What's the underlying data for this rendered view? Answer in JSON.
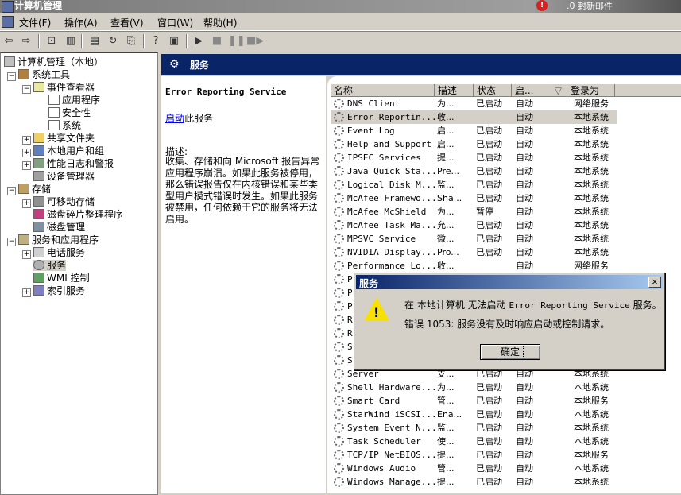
{
  "window": {
    "title": "计算机管理",
    "icon": "computer-management-icon"
  },
  "notification": {
    "text": ".0 封新邮件",
    "badge": "!"
  },
  "menu": [
    "文件(F)",
    "操作(A)",
    "查看(V)",
    "窗口(W)",
    "帮助(H)"
  ],
  "toolbar_icons": [
    "back-icon",
    "forward-icon",
    "up-icon",
    "show-tree-icon",
    "properties-icon",
    "refresh-icon",
    "export-icon",
    "help-icon",
    "console-icon",
    "play-icon",
    "stop-icon",
    "pause-icon",
    "restart-icon"
  ],
  "tree": {
    "root": "计算机管理（本地）",
    "items": [
      {
        "label": "系统工具",
        "icon": "tools-icon"
      },
      {
        "label": "事件查看器",
        "icon": "event-viewer-icon"
      },
      {
        "label": "应用程序",
        "icon": "log-icon"
      },
      {
        "label": "安全性",
        "icon": "log-icon"
      },
      {
        "label": "系统",
        "icon": "log-icon"
      },
      {
        "label": "共享文件夹",
        "icon": "folder-icon"
      },
      {
        "label": "本地用户和组",
        "icon": "users-icon"
      },
      {
        "label": "性能日志和警报",
        "icon": "performance-icon"
      },
      {
        "label": "设备管理器",
        "icon": "device-icon"
      },
      {
        "label": "存储",
        "icon": "storage-icon"
      },
      {
        "label": "可移动存储",
        "icon": "removable-icon"
      },
      {
        "label": "磁盘碎片整理程序",
        "icon": "defrag-icon"
      },
      {
        "label": "磁盘管理",
        "icon": "disk-icon"
      },
      {
        "label": "服务和应用程序",
        "icon": "services-apps-icon"
      },
      {
        "label": "电话服务",
        "icon": "telephony-icon"
      },
      {
        "label": "服务",
        "icon": "services-icon"
      },
      {
        "label": "WMI 控制",
        "icon": "wmi-icon"
      },
      {
        "label": "索引服务",
        "icon": "index-icon"
      }
    ]
  },
  "panel": {
    "header": "服务"
  },
  "description": {
    "service_title": "Error Reporting Service",
    "start_link": "启动",
    "start_suffix": "此服务",
    "label": "描述:",
    "body": "收集、存储和向 Microsoft 报告异常应用程序崩溃。如果此服务被停用，那么错误报告仅在内核错误和某些类型用户模式错误时发生。如果此服务被禁用，任何依赖于它的服务将无法启用。"
  },
  "columns": [
    "名称",
    "描述",
    "状态",
    "启...",
    "登录为"
  ],
  "services": [
    {
      "name": "DNS Client",
      "desc": "为...",
      "status": "已启动",
      "startup": "自动",
      "logon": "网络服务"
    },
    {
      "name": "Error Reportin...",
      "desc": "收...",
      "status": "",
      "startup": "自动",
      "logon": "本地系统"
    },
    {
      "name": "Event Log",
      "desc": "启...",
      "status": "已启动",
      "startup": "自动",
      "logon": "本地系统"
    },
    {
      "name": "Help and Support",
      "desc": "启...",
      "status": "已启动",
      "startup": "自动",
      "logon": "本地系统"
    },
    {
      "name": "IPSEC Services",
      "desc": "提...",
      "status": "已启动",
      "startup": "自动",
      "logon": "本地系统"
    },
    {
      "name": "Java Quick Sta...",
      "desc": "Pre...",
      "status": "已启动",
      "startup": "自动",
      "logon": "本地系统"
    },
    {
      "name": "Logical Disk M...",
      "desc": "监...",
      "status": "已启动",
      "startup": "自动",
      "logon": "本地系统"
    },
    {
      "name": "McAfee Framewo...",
      "desc": "Sha...",
      "status": "已启动",
      "startup": "自动",
      "logon": "本地系统"
    },
    {
      "name": "McAfee McShield",
      "desc": "为...",
      "status": "暂停",
      "startup": "自动",
      "logon": "本地系统"
    },
    {
      "name": "McAfee Task Ma...",
      "desc": "允...",
      "status": "已启动",
      "startup": "自动",
      "logon": "本地系统"
    },
    {
      "name": "MPSVC Service",
      "desc": "微...",
      "status": "已启动",
      "startup": "自动",
      "logon": "本地系统"
    },
    {
      "name": "NVIDIA Display...",
      "desc": "Pro...",
      "status": "已启动",
      "startup": "自动",
      "logon": "本地系统"
    },
    {
      "name": "Performance Lo...",
      "desc": "收...",
      "status": "",
      "startup": "自动",
      "logon": "网络服务"
    },
    {
      "name": "P",
      "desc": "",
      "status": "",
      "startup": "",
      "logon": ""
    },
    {
      "name": "P",
      "desc": "",
      "status": "",
      "startup": "",
      "logon": ""
    },
    {
      "name": "P",
      "desc": "",
      "status": "",
      "startup": "",
      "logon": ""
    },
    {
      "name": "R",
      "desc": "",
      "status": "",
      "startup": "",
      "logon": ""
    },
    {
      "name": "R",
      "desc": "",
      "status": "",
      "startup": "",
      "logon": ""
    },
    {
      "name": "S",
      "desc": "",
      "status": "",
      "startup": "",
      "logon": ""
    },
    {
      "name": "S",
      "desc": "",
      "status": "",
      "startup": "",
      "logon": ""
    },
    {
      "name": "Server",
      "desc": "支...",
      "status": "已启动",
      "startup": "自动",
      "logon": "本地系统"
    },
    {
      "name": "Shell Hardware...",
      "desc": "为...",
      "status": "已启动",
      "startup": "自动",
      "logon": "本地系统"
    },
    {
      "name": "Smart Card",
      "desc": "管...",
      "status": "已启动",
      "startup": "自动",
      "logon": "本地服务"
    },
    {
      "name": "StarWind iSCSI...",
      "desc": "Ena...",
      "status": "已启动",
      "startup": "自动",
      "logon": "本地系统"
    },
    {
      "name": "System Event N...",
      "desc": "监...",
      "status": "已启动",
      "startup": "自动",
      "logon": "本地系统"
    },
    {
      "name": "Task Scheduler",
      "desc": "使...",
      "status": "已启动",
      "startup": "自动",
      "logon": "本地系统"
    },
    {
      "name": "TCP/IP NetBIOS...",
      "desc": "提...",
      "status": "已启动",
      "startup": "自动",
      "logon": "本地服务"
    },
    {
      "name": "Windows Audio",
      "desc": "管...",
      "status": "已启动",
      "startup": "自动",
      "logon": "本地系统"
    },
    {
      "name": "Windows Manage...",
      "desc": "提...",
      "status": "已启动",
      "startup": "自动",
      "logon": "本地系统"
    }
  ],
  "dialog": {
    "title": "服务",
    "close": "×",
    "icon": "warning-icon",
    "msg_prefix": "在 本地计算机 无法启动 ",
    "msg_service": "Error Reporting Service",
    "msg_suffix": " 服务。",
    "error": "错误 1053: 服务没有及时响应启动或控制请求。",
    "ok": "确定"
  }
}
